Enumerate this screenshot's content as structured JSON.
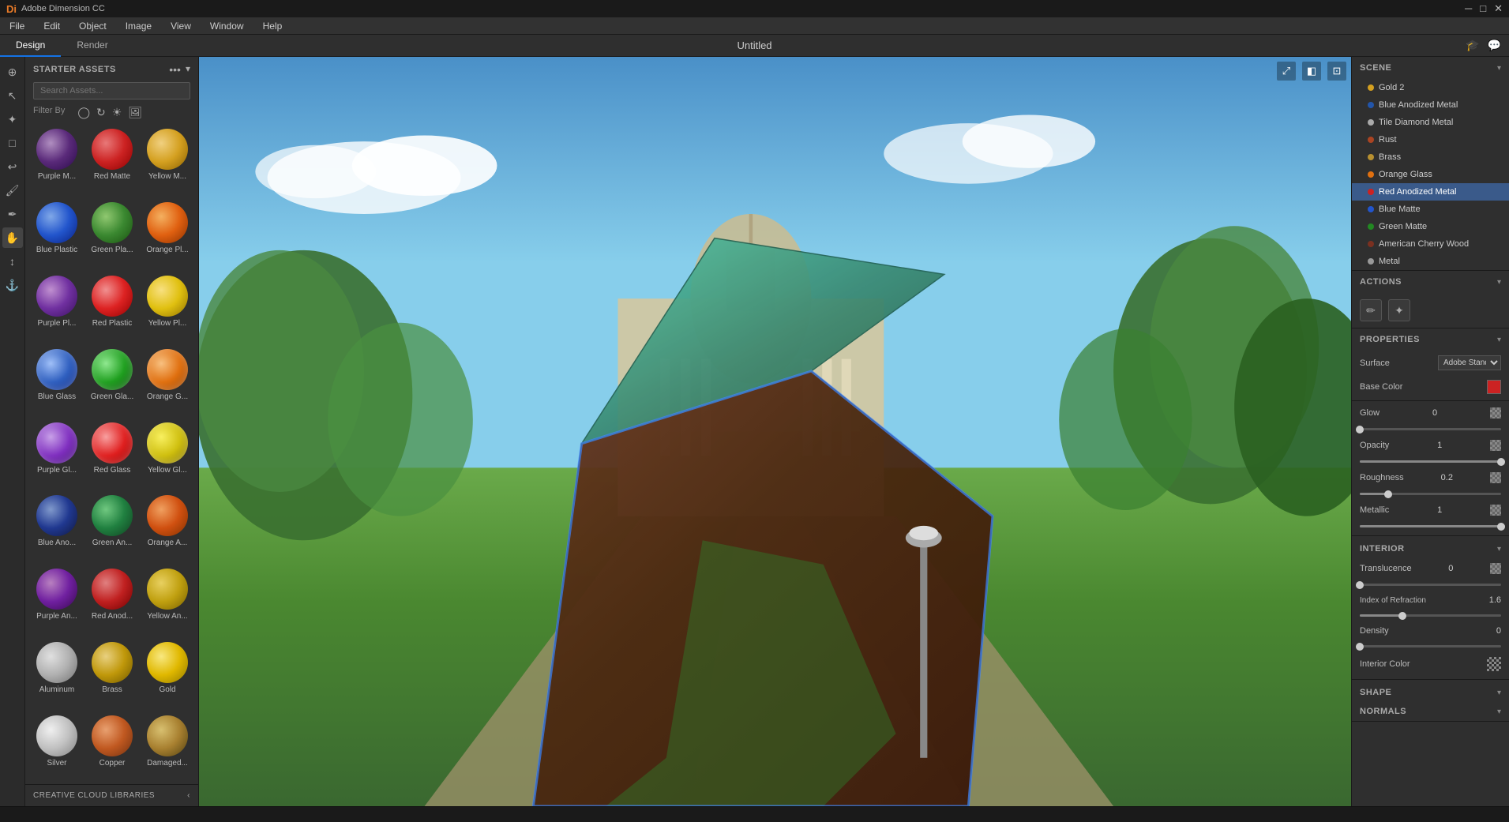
{
  "app": {
    "title": "Adobe Dimension CC",
    "window_title": "Adobe Dimension CC"
  },
  "titlebar": {
    "title": "Adobe Dimension CC",
    "minimize": "─",
    "maximize": "□",
    "close": "✕"
  },
  "menubar": {
    "items": [
      "File",
      "Edit",
      "Object",
      "Image",
      "View",
      "Window",
      "Help"
    ]
  },
  "tabs": {
    "design": "Design",
    "render": "Render",
    "doc_title": "Untitled"
  },
  "assets": {
    "panel_title": "STARTER ASSETS",
    "search_placeholder": "Search Assets...",
    "cc_libraries": "CREATIVE CLOUD LIBRARIES"
  },
  "materials": [
    {
      "label": "Purple M...",
      "class": "purple-m"
    },
    {
      "label": "Red Matte",
      "class": "red-matte"
    },
    {
      "label": "Yellow M...",
      "class": "yellow-m"
    },
    {
      "label": "Blue Plastic",
      "class": "blue-plastic"
    },
    {
      "label": "Green Pla...",
      "class": "green-pla"
    },
    {
      "label": "Orange Pl...",
      "class": "orange-pl"
    },
    {
      "label": "Purple Pl...",
      "class": "purple-pl"
    },
    {
      "label": "Red Plastic",
      "class": "red-plastic"
    },
    {
      "label": "Yellow Pl...",
      "class": "yellow-pl"
    },
    {
      "label": "Blue Glass",
      "class": "blue-glass"
    },
    {
      "label": "Green Gla...",
      "class": "green-gla"
    },
    {
      "label": "Orange G...",
      "class": "orange-g"
    },
    {
      "label": "Purple Gl...",
      "class": "purple-gl"
    },
    {
      "label": "Red Glass",
      "class": "red-glass"
    },
    {
      "label": "Yellow Gl...",
      "class": "yellow-gl"
    },
    {
      "label": "Blue Ano...",
      "class": "blue-ano"
    },
    {
      "label": "Green An...",
      "class": "green-an"
    },
    {
      "label": "Orange A...",
      "class": "orange-a"
    },
    {
      "label": "Purple An...",
      "class": "purple-an"
    },
    {
      "label": "Red Anod...",
      "class": "red-anod"
    },
    {
      "label": "Yellow An...",
      "class": "yellow-an"
    },
    {
      "label": "Aluminum",
      "class": "aluminum"
    },
    {
      "label": "Brass",
      "class": "brass"
    },
    {
      "label": "Gold",
      "class": "gold"
    },
    {
      "label": "Silver",
      "class": "silver"
    },
    {
      "label": "Copper",
      "class": "copper"
    },
    {
      "label": "Damaged...",
      "class": "damaged"
    }
  ],
  "scene": {
    "title": "SCENE",
    "items": [
      {
        "name": "Gold 2",
        "color": "#d4a020"
      },
      {
        "name": "Blue Anodized Metal",
        "color": "#2255aa"
      },
      {
        "name": "Tile Diamond Metal",
        "color": "#aaaaaa"
      },
      {
        "name": "Rust",
        "color": "#aa4422"
      },
      {
        "name": "Brass",
        "color": "#b89030"
      },
      {
        "name": "Orange Glass",
        "color": "#e07010"
      },
      {
        "name": "Red Anodized Metal",
        "color": "#cc2222",
        "selected": true
      },
      {
        "name": "Blue Matte",
        "color": "#2255cc"
      },
      {
        "name": "Green Matte",
        "color": "#228822"
      },
      {
        "name": "American Cherry Wood",
        "color": "#7a3020"
      },
      {
        "name": "Metal",
        "color": "#999999"
      }
    ]
  },
  "actions": {
    "title": "ACTIONS",
    "edit_icon": "✏",
    "eyedropper_icon": "✦"
  },
  "properties": {
    "title": "PROPERTIES",
    "surface_label": "Surface",
    "surface_value": "▾",
    "base_color_label": "Base Color",
    "base_color": "#cc2222",
    "glow_label": "Glow",
    "glow_value": "0",
    "glow_percent": 0,
    "opacity_label": "Opacity",
    "opacity_value": "1",
    "opacity_percent": 100,
    "roughness_label": "Roughness",
    "roughness_value": "0.2",
    "roughness_percent": 20,
    "metallic_label": "Metallic",
    "metallic_value": "1",
    "metallic_percent": 100,
    "interior_label": "Interior",
    "translucence_label": "Translucence",
    "translucence_value": "0",
    "translucence_percent": 0,
    "ior_label": "Index of Refraction",
    "ior_value": "1.6",
    "ior_percent": 30,
    "density_label": "Density",
    "density_value": "0",
    "density_percent": 0,
    "interior_color_label": "Interior Color",
    "shape_label": "Shape",
    "normals_label": "Normals"
  }
}
